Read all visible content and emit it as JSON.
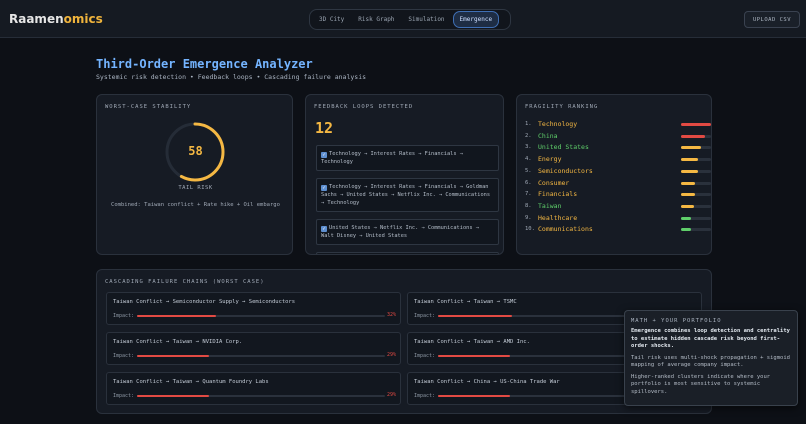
{
  "brand": {
    "prefix": "Raamen",
    "highlight": "omics"
  },
  "nav": {
    "tabs": [
      "3D City",
      "Risk Graph",
      "Simulation",
      "Emergence"
    ],
    "active": 3
  },
  "upload_label": "UPLOAD CSV",
  "header": {
    "title": "Third-Order Emergence Analyzer",
    "subtitle": "Systemic risk detection • Feedback loops • Cascading failure analysis"
  },
  "stability": {
    "heading": "WORST-CASE STABILITY",
    "value": "58",
    "level": 0.58,
    "label": "TAIL RISK",
    "combined": "Combined: Taiwan conflict + Rate hike + Oil embargo",
    "color": "#f5b843"
  },
  "loops": {
    "heading": "FEEDBACK LOOPS DETECTED",
    "count": "12",
    "items": [
      "Technology → Interest Rates → Financials → Technology",
      "Technology → Interest Rates → Financials → Goldman Sachs → United States → Netflix Inc. → Communications → Technology",
      "United States → Netflix Inc. → Communications → Walt Disney → United States"
    ]
  },
  "fragility": {
    "heading": "FRAGILITY RANKING",
    "items": [
      {
        "rank": "1.",
        "name": "Technology",
        "color": "#f5b843",
        "level": 1.0,
        "bar": "#e24a43"
      },
      {
        "rank": "2.",
        "name": "China",
        "color": "#5fcf6a",
        "level": 0.8,
        "bar": "#e24a43"
      },
      {
        "rank": "3.",
        "name": "United States",
        "color": "#5fcf6a",
        "level": 0.68,
        "bar": "#f5b843"
      },
      {
        "rank": "4.",
        "name": "Energy",
        "color": "#f5b843",
        "level": 0.57,
        "bar": "#f5b843"
      },
      {
        "rank": "5.",
        "name": "Semiconductors",
        "color": "#f5b843",
        "level": 0.55,
        "bar": "#f5b843"
      },
      {
        "rank": "6.",
        "name": "Consumer",
        "color": "#f5b843",
        "level": 0.47,
        "bar": "#f5b843"
      },
      {
        "rank": "7.",
        "name": "Financials",
        "color": "#f5b843",
        "level": 0.45,
        "bar": "#f5b843"
      },
      {
        "rank": "8.",
        "name": "Taiwan",
        "color": "#5fcf6a",
        "level": 0.43,
        "bar": "#f5b843"
      },
      {
        "rank": "9.",
        "name": "Healthcare",
        "color": "#f5b843",
        "level": 0.33,
        "bar": "#5fcf6a"
      },
      {
        "rank": "10.",
        "name": "Communications",
        "color": "#f5b843",
        "level": 0.33,
        "bar": "#5fcf6a"
      }
    ]
  },
  "cascades": {
    "heading": "CASCADING FAILURE CHAINS (WORST CASE)",
    "impact_label": "Impact:",
    "items": [
      {
        "chain": "Taiwan Conflict → Semiconductor Supply → Semiconductors",
        "impact": 0.32,
        "pct": "32%"
      },
      {
        "chain": "Taiwan Conflict → Taiwan → TSMC",
        "impact": 0.3,
        "pct": ""
      },
      {
        "chain": "Taiwan Conflict → Taiwan → NVIDIA Corp.",
        "impact": 0.29,
        "pct": "29%"
      },
      {
        "chain": "Taiwan Conflict → Taiwan → AMD Inc.",
        "impact": 0.29,
        "pct": ""
      },
      {
        "chain": "Taiwan Conflict → Taiwan → Quantum Foundry Labs",
        "impact": 0.29,
        "pct": "29%"
      },
      {
        "chain": "Taiwan Conflict → China → US-China Trade War",
        "impact": 0.29,
        "pct": ""
      }
    ]
  },
  "popup": {
    "heading": "MATH + YOUR PORTFOLIO",
    "p1": "Emergence combines loop detection and centrality to estimate hidden cascade risk beyond first-order shocks.",
    "p2": "Tail risk uses multi-shock propagation + sigmoid mapping of average company impact.",
    "p3": "Higher-ranked clusters indicate where your portfolio is most sensitive to systemic spillovers."
  }
}
